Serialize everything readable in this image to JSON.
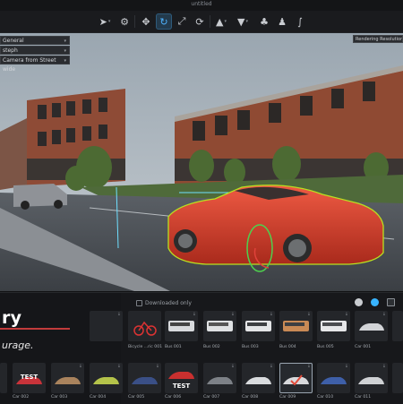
{
  "window": {
    "title": "untitled"
  },
  "toolbar": {
    "icons": [
      "select-arrow",
      "node-tool",
      "move-gizmo",
      "rotate-gizmo",
      "scale-gizmo",
      "snap-tool",
      "camera-tool",
      "light-tool",
      "tree-tool",
      "people-tool",
      "path-tool"
    ]
  },
  "viewport": {
    "dropdowns": [
      {
        "label": "General"
      },
      {
        "label": "steph"
      },
      {
        "label": "Camera from Street wide"
      }
    ],
    "render_badge": "Rendering Resolution: 1920"
  },
  "library": {
    "heading": "ry",
    "tagline": "urage.",
    "filter_label": "Downloaded only",
    "top_row": [
      {
        "caption": ""
      },
      {
        "caption": "Bicycle ...ric 001"
      },
      {
        "caption": "Bus 001"
      },
      {
        "caption": "Bus 002"
      },
      {
        "caption": "Bus 003"
      },
      {
        "caption": "Bus 004"
      },
      {
        "caption": "Bus 005"
      },
      {
        "caption": "Car 001"
      },
      {
        "caption": ""
      }
    ],
    "bottom_row": [
      {
        "caption": "",
        "tag": ""
      },
      {
        "caption": "Car 002",
        "tag": "TEST"
      },
      {
        "caption": "Car 003",
        "tag": ""
      },
      {
        "caption": "Car 004",
        "tag": ""
      },
      {
        "caption": "Car 005",
        "tag": ""
      },
      {
        "caption": "Car 006",
        "tag": "TEST"
      },
      {
        "caption": "Car 007",
        "tag": ""
      },
      {
        "caption": "Car 008",
        "tag": ""
      },
      {
        "caption": "Car 009",
        "tag": ""
      },
      {
        "caption": "Car 010",
        "tag": ""
      },
      {
        "caption": "Car 011",
        "tag": ""
      }
    ]
  },
  "colors": {
    "accent": "#4fb3ff",
    "car": "#d8422f",
    "highlight": "#b8e020",
    "selection_red": "#c23b3b"
  }
}
